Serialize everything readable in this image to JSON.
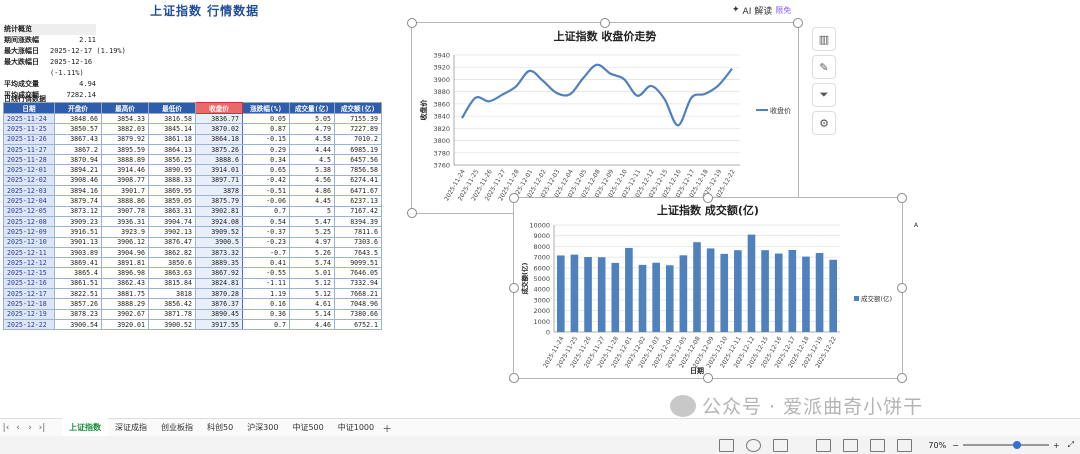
{
  "title": "上证指数 行情数据",
  "ai": {
    "label": "AI 解读",
    "badge": "限免"
  },
  "stats": {
    "header": "统计概览",
    "rows": [
      {
        "k": "期间涨跌幅",
        "v": "2.11"
      },
      {
        "k": "最大涨幅日",
        "v": "2025-12-17 (1.19%)"
      },
      {
        "k": "最大跌幅日",
        "v": "2025-12-16 (-1.11%)"
      },
      {
        "k": "平均成交量",
        "v": "4.94"
      },
      {
        "k": "平均成交额",
        "v": "7282.14"
      }
    ]
  },
  "table": {
    "title": "日线行情数据",
    "headers": [
      "日期",
      "开盘价",
      "最高价",
      "最低价",
      "收盘价",
      "涨跌幅(%)",
      "成交量(亿)",
      "成交额(亿)"
    ],
    "rows": [
      [
        "2025-11-24",
        "3848.66",
        "3854.33",
        "3816.58",
        "3836.77",
        "0.05",
        "5.05",
        "7155.39"
      ],
      [
        "2025-11-25",
        "3850.57",
        "3882.03",
        "3845.14",
        "3870.02",
        "0.87",
        "4.79",
        "7227.89"
      ],
      [
        "2025-11-26",
        "3867.43",
        "3879.92",
        "3861.18",
        "3864.18",
        "-0.15",
        "4.58",
        "7010.2"
      ],
      [
        "2025-11-27",
        "3867.2",
        "3895.59",
        "3864.13",
        "3875.26",
        "0.29",
        "4.44",
        "6985.19"
      ],
      [
        "2025-11-28",
        "3870.94",
        "3888.89",
        "3856.25",
        "3888.6",
        "0.34",
        "4.5",
        "6457.56"
      ],
      [
        "2025-12-01",
        "3894.21",
        "3914.46",
        "3890.95",
        "3914.01",
        "0.65",
        "5.38",
        "7856.58"
      ],
      [
        "2025-12-02",
        "3908.46",
        "3908.77",
        "3888.33",
        "3897.71",
        "-0.42",
        "4.56",
        "6274.41"
      ],
      [
        "2025-12-03",
        "3894.16",
        "3901.7",
        "3869.95",
        "3878",
        "-0.51",
        "4.86",
        "6471.67"
      ],
      [
        "2025-12-04",
        "3879.74",
        "3888.86",
        "3859.05",
        "3875.79",
        "-0.06",
        "4.45",
        "6237.13"
      ],
      [
        "2025-12-05",
        "3873.12",
        "3907.78",
        "3863.31",
        "3902.81",
        "0.7",
        "5",
        "7167.42"
      ],
      [
        "2025-12-08",
        "3909.23",
        "3936.31",
        "3904.74",
        "3924.08",
        "0.54",
        "5.47",
        "8394.39"
      ],
      [
        "2025-12-09",
        "3916.51",
        "3923.9",
        "3902.13",
        "3909.52",
        "-0.37",
        "5.25",
        "7811.6"
      ],
      [
        "2025-12-10",
        "3901.13",
        "3906.12",
        "3876.47",
        "3900.5",
        "-0.23",
        "4.97",
        "7303.6"
      ],
      [
        "2025-12-11",
        "3903.89",
        "3904.96",
        "3862.82",
        "3873.32",
        "-0.7",
        "5.26",
        "7643.5"
      ],
      [
        "2025-12-12",
        "3869.41",
        "3891.81",
        "3850.6",
        "3889.35",
        "0.41",
        "5.74",
        "9099.51"
      ],
      [
        "2025-12-15",
        "3865.4",
        "3896.98",
        "3863.63",
        "3867.92",
        "-0.55",
        "5.01",
        "7646.05"
      ],
      [
        "2025-12-16",
        "3861.51",
        "3862.43",
        "3815.84",
        "3824.81",
        "-1.11",
        "5.12",
        "7332.94"
      ],
      [
        "2025-12-17",
        "3822.51",
        "3881.75",
        "3818",
        "3870.28",
        "1.19",
        "5.12",
        "7668.21"
      ],
      [
        "2025-12-18",
        "3857.26",
        "3888.29",
        "3856.42",
        "3876.37",
        "0.16",
        "4.61",
        "7048.96"
      ],
      [
        "2025-12-19",
        "3878.23",
        "3902.67",
        "3871.78",
        "3890.45",
        "0.36",
        "5.14",
        "7380.66"
      ],
      [
        "2025-12-22",
        "3900.54",
        "3920.01",
        "3900.52",
        "3917.55",
        "0.7",
        "4.46",
        "6752.1"
      ]
    ]
  },
  "chart_data": [
    {
      "type": "line",
      "title": "上证指数 收盘价走势",
      "ylabel": "收盘价",
      "xlabel": "",
      "ylim": [
        3760,
        3940
      ],
      "yticks": [
        3760,
        3780,
        3800,
        3820,
        3840,
        3860,
        3880,
        3900,
        3920,
        3940
      ],
      "x": [
        "2025-11-24",
        "2025-11-25",
        "2025-11-26",
        "2025-11-27",
        "2025-11-28",
        "2025-12-01",
        "2025-12-02",
        "2025-12-03",
        "2025-12-04",
        "2025-12-05",
        "2025-12-08",
        "2025-12-09",
        "2025-12-10",
        "2025-12-11",
        "2025-12-12",
        "2025-12-15",
        "2025-12-16",
        "2025-12-17",
        "2025-12-18",
        "2025-12-19",
        "2025-12-22"
      ],
      "series": [
        {
          "name": "收盘价",
          "values": [
            3836.77,
            3870.02,
            3864.18,
            3875.26,
            3888.6,
            3914.01,
            3897.71,
            3878,
            3875.79,
            3902.81,
            3924.08,
            3909.52,
            3900.5,
            3873.32,
            3889.35,
            3867.92,
            3824.81,
            3870.28,
            3876.37,
            3890.45,
            3917.55
          ]
        }
      ],
      "legend": "right",
      "color": "#4f81bd"
    },
    {
      "type": "bar",
      "title": "上证指数 成交额(亿)",
      "ylabel": "成交额(亿)",
      "xlabel": "日期",
      "ylim": [
        0,
        10000
      ],
      "yticks": [
        0,
        1000,
        2000,
        3000,
        4000,
        5000,
        6000,
        7000,
        8000,
        9000,
        10000
      ],
      "x": [
        "2025-11-24",
        "2025-11-25",
        "2025-11-26",
        "2025-11-27",
        "2025-11-28",
        "2025-12-01",
        "2025-12-02",
        "2025-12-03",
        "2025-12-04",
        "2025-12-05",
        "2025-12-08",
        "2025-12-09",
        "2025-12-10",
        "2025-12-11",
        "2025-12-12",
        "2025-12-15",
        "2025-12-16",
        "2025-12-17",
        "2025-12-18",
        "2025-12-19",
        "2025-12-22"
      ],
      "series": [
        {
          "name": "成交额(亿)",
          "values": [
            7155.39,
            7227.89,
            7010.2,
            6985.19,
            6457.56,
            7856.58,
            6274.41,
            6471.67,
            6237.13,
            7167.42,
            8394.39,
            7811.6,
            7303.6,
            7643.5,
            9099.51,
            7646.05,
            7332.94,
            7668.21,
            7048.96,
            7380.66,
            6752.1
          ]
        }
      ],
      "legend": "right",
      "color": "#4f81bd"
    }
  ],
  "stray_cell": "A",
  "watermark": "公众号 · 爱派曲奇小饼干",
  "sheets": [
    "上证指数",
    "深证成指",
    "创业板指",
    "科创50",
    "沪深300",
    "中证500",
    "中证1000"
  ],
  "active_sheet": "上证指数",
  "zoom": "70%"
}
